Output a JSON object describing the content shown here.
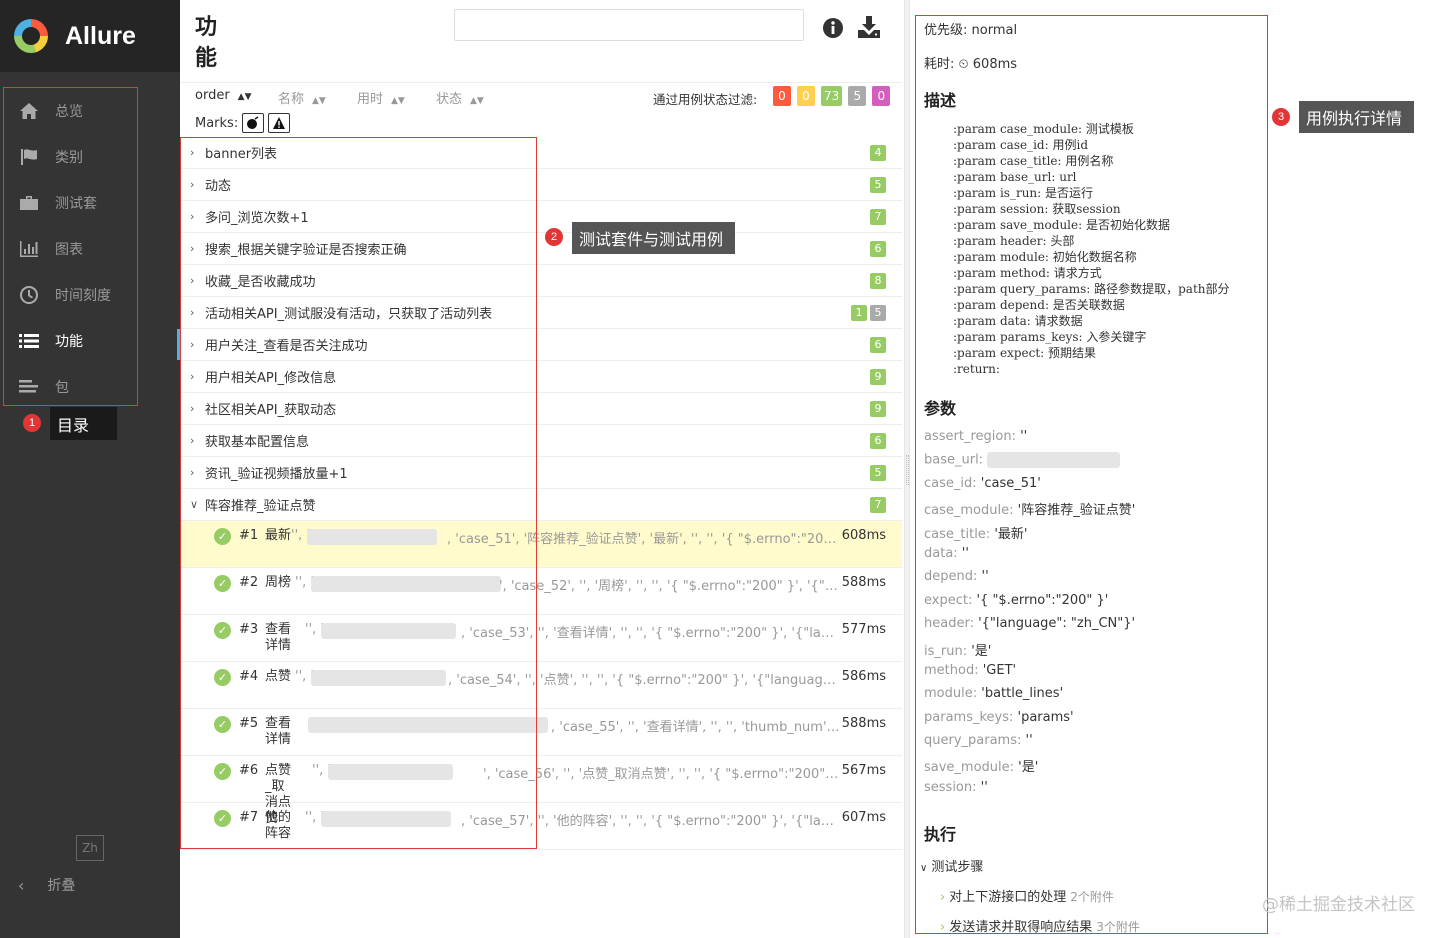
{
  "app": {
    "name": "Allure"
  },
  "sidebar": {
    "items": [
      {
        "label": "总览",
        "icon": "home-icon"
      },
      {
        "label": "类别",
        "icon": "flag-icon"
      },
      {
        "label": "测试套",
        "icon": "briefcase-icon"
      },
      {
        "label": "图表",
        "icon": "bar-chart-icon"
      },
      {
        "label": "时间刻度",
        "icon": "clock-icon"
      },
      {
        "label": "功能",
        "icon": "list-icon",
        "active": true
      },
      {
        "label": "包",
        "icon": "package-icon"
      }
    ],
    "lang": "Zh",
    "collapse": "折叠"
  },
  "annotations": {
    "a1": {
      "num": "1",
      "text": "目录"
    },
    "a2": {
      "num": "2",
      "text": "测试套件与测试用例"
    },
    "a3": {
      "num": "3",
      "text": "用例执行详情"
    }
  },
  "main": {
    "title": "功能",
    "sort": {
      "order": "order",
      "name": "名称",
      "duration": "用时",
      "status": "状态"
    },
    "filter_label": "通过用例状态过滤:",
    "filter_counts": [
      {
        "value": "0",
        "color": "#fd5a3e"
      },
      {
        "value": "0",
        "color": "#ffd050"
      },
      {
        "value": "73",
        "color": "#97cc64"
      },
      {
        "value": "5",
        "color": "#aaaaaa"
      },
      {
        "value": "0",
        "color": "#d35ebe"
      }
    ],
    "marks_label": "Marks:",
    "groups": [
      {
        "name": "banner列表",
        "counts": [
          "4"
        ]
      },
      {
        "name": "动态",
        "counts": [
          "5"
        ]
      },
      {
        "name": "多问_浏览次数+1",
        "counts": [
          "7"
        ]
      },
      {
        "name": "搜索_根据关键字验证是否搜索正确",
        "counts": [
          "6"
        ]
      },
      {
        "name": "收藏_是否收藏成功",
        "counts": [
          "8"
        ]
      },
      {
        "name": "活动相关API_测试服没有活动，只获取了活动列表",
        "counts": [
          "1",
          "5"
        ]
      },
      {
        "name": "用户关注_查看是否关注成功",
        "counts": [
          "6"
        ],
        "selected": true
      },
      {
        "name": "用户相关API_修改信息",
        "counts": [
          "9"
        ]
      },
      {
        "name": "社区相关API_获取动态",
        "counts": [
          "9"
        ]
      },
      {
        "name": "获取基本配置信息",
        "counts": [
          "6"
        ]
      },
      {
        "name": "资讯_验证视频播放量+1",
        "counts": [
          "5"
        ]
      },
      {
        "name": "阵容推荐_验证点赞",
        "counts": [
          "7"
        ],
        "expanded": true
      }
    ],
    "cases": [
      {
        "num": "#1",
        "title": "最新",
        "pre": "'', '",
        "params": ", 'case_51', '阵容推荐_验证点赞', '最新', '', '', '{ \"$.errno\":\"200\" }', '...",
        "time": "608ms"
      },
      {
        "num": "#2",
        "title": "周榜",
        "pre": "'', '",
        "params": "', 'case_52', '', '周榜', '', '', '{ \"$.errno\":\"200\" }', '{\"langua...",
        "time": "588ms"
      },
      {
        "num": "#3",
        "title": "查看详情",
        "pre": "'', '",
        "params": ", 'case_53', '', '查看详情', '', '', '{ \"$.errno\":\"200\" }', '{\"language...",
        "time": "577ms"
      },
      {
        "num": "#4",
        "title": "点赞",
        "pre": "'', '",
        "params": ", 'case_54', '', '点赞', '', '', '{ \"$.errno\":\"200\" }', '{\"language\": \"zh_...",
        "time": "586ms"
      },
      {
        "num": "#5",
        "title": "查看详情",
        "pre": "",
        "params": ", 'case_55', '', '查看详情', '', '', 'thumb_num', '{\"l...",
        "time": "588ms"
      },
      {
        "num": "#6",
        "title": "点赞_取消点赞",
        "pre": "'', '",
        "params": "', 'case_56', '', '点赞_取消点赞', '', '', '{ \"$.errno\":\"200\" }', '{\"...",
        "time": "567ms"
      },
      {
        "num": "#7",
        "title": "他的阵容",
        "pre": "'', '",
        "params": ", 'case_57', '', '他的阵容', '', '', '{ \"$.errno\":\"200\" }', '{\"language...",
        "time": "607ms"
      }
    ]
  },
  "detail": {
    "priority": "优先级: normal",
    "duration": "耗时: ⏲ 608ms",
    "desc_title": "描述",
    "desc_body": ":param case_module: 测试模板\n:param case_id: 用例id\n:param case_title: 用例名称\n:param base_url: url\n:param is_run: 是否运行\n:param session: 获取session\n:param save_module: 是否初始化数据\n:param header: 头部\n:param module: 初始化数据名称\n:param method: 请求方式\n:param query_params: 路径参数提取，path部分\n:param depend: 是否关联数据\n:param data: 请求数据\n:param params_keys: 入参关键字\n:param expect: 预期结果\n:return:",
    "params_title": "参数",
    "params": [
      {
        "k": "assert_region:",
        "v": " ''"
      },
      {
        "k": "base_url:",
        "v": ""
      },
      {
        "k": "case_id:",
        "v": " 'case_51'"
      },
      {
        "k": "case_module:",
        "v": " '阵容推荐_验证点赞'"
      },
      {
        "k": "case_title:",
        "v": " '最新'"
      },
      {
        "k": "data:",
        "v": " ''"
      },
      {
        "k": "depend:",
        "v": " ''"
      },
      {
        "k": "expect:",
        "v": " '{ \"$.errno\":\"200\" }'"
      },
      {
        "k": "header:",
        "v": " '{\"language\": \"zh_CN\"}'"
      },
      {
        "k": "is_run:",
        "v": " '是'"
      },
      {
        "k": "method:",
        "v": " 'GET'"
      },
      {
        "k": "module:",
        "v": " 'battle_lines'"
      },
      {
        "k": "params_keys:",
        "v": " 'params'"
      },
      {
        "k": "query_params:",
        "v": " ''"
      },
      {
        "k": "save_module:",
        "v": " '是'"
      },
      {
        "k": "session:",
        "v": " ''"
      }
    ],
    "exec_title": "执行",
    "steps_title": "测试步骤",
    "steps": [
      {
        "name": "对上下游接口的处理",
        "att": "2个附件"
      },
      {
        "name": "发送请求并取得响应结果",
        "att": "3个附件"
      }
    ]
  },
  "watermark": "@稀土掘金技术社区"
}
